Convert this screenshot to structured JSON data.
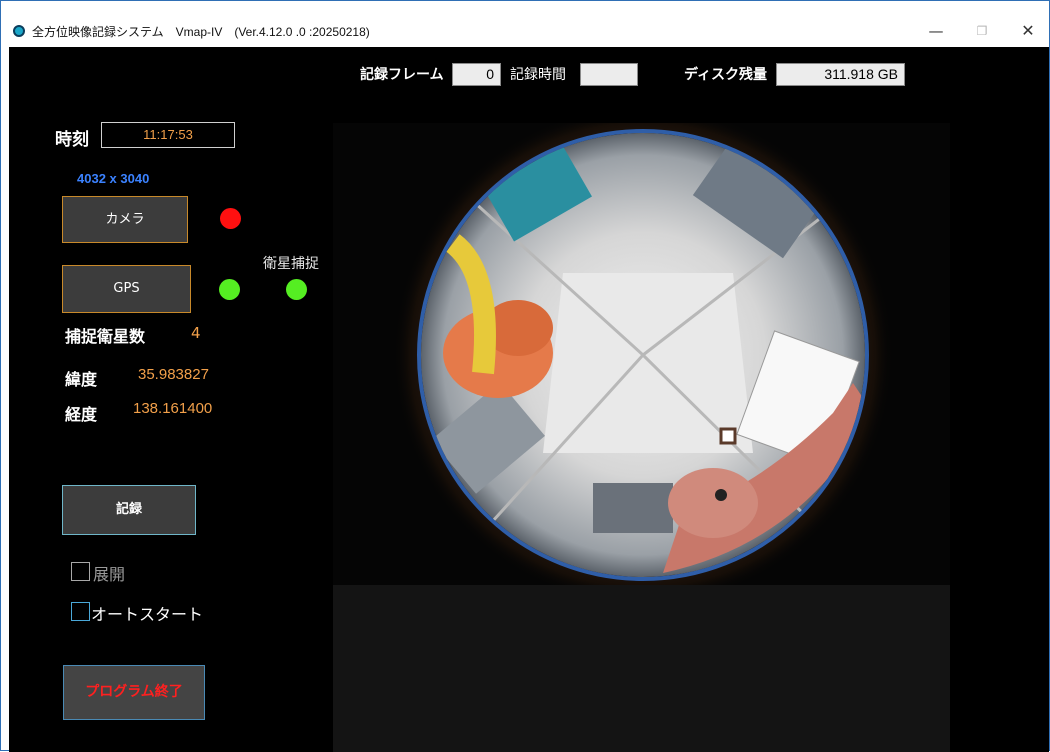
{
  "window": {
    "title": "全方位映像記録システム　Vmap-IV　(Ver.4.12.0 .0 :20250218)",
    "controls": {
      "minimize": "—",
      "maximize": "❐",
      "close": "✕"
    }
  },
  "top_bar": {
    "record_frame_label": "記録フレーム",
    "record_frame_value": "0",
    "record_time_label": "記録時間",
    "record_time_value": "",
    "disk_label": "ディスク残量",
    "disk_value": "311.918 GB"
  },
  "left_panel": {
    "time_label": "時刻",
    "time_value": "11:17:53",
    "resolution": "4032 x 3040",
    "camera_button": "カメラ",
    "camera_status": "red",
    "gps_button": "GPS",
    "gps_status": "green",
    "satellite_capture_label": "衛星捕捉",
    "satellite_capture_status": "green",
    "satellite_count_label": "捕捉衛星数",
    "satellite_count_value": "4",
    "latitude_label": "緯度",
    "latitude_value": "35.983827",
    "longitude_label": "経度",
    "longitude_value": "138.161400",
    "record_button": "記録",
    "expand_checkbox_label": "展開",
    "expand_checked": false,
    "autostart_checkbox_label": "オートスタート",
    "autostart_checked": false,
    "exit_button": "プログラム終了"
  },
  "colors": {
    "accent_orange": "#f2a04a",
    "resolution_blue": "#3b82ff",
    "led_red": "#ff1010",
    "led_green": "#55ee22",
    "exit_red": "#ff2020"
  }
}
